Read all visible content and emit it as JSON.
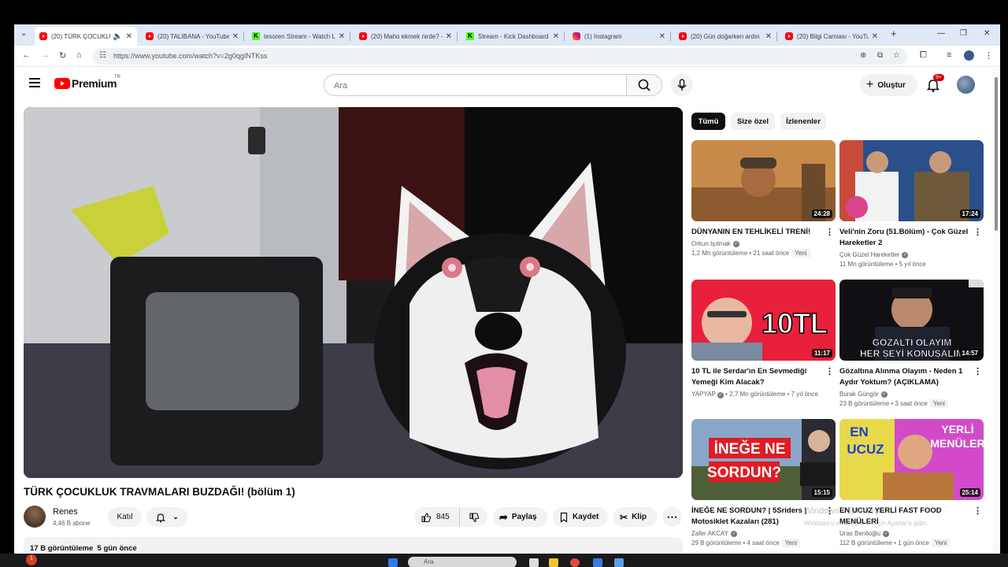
{
  "browser": {
    "tabs": [
      {
        "title": "(20) TÜRK ÇOCUKLUK",
        "icon": "youtube-icon",
        "active": true,
        "audio": true
      },
      {
        "title": "(20) TALIBANA - YouTube",
        "icon": "youtube-icon"
      },
      {
        "title": "texoren Stream - Watch L",
        "icon": "kick-icon"
      },
      {
        "title": "(20) Maho ekmek nirde? -",
        "icon": "youtube-icon"
      },
      {
        "title": "Stream - Kick Dashboard",
        "icon": "kick-icon"
      },
      {
        "title": "(1) Instagram",
        "icon": "instagram-icon"
      },
      {
        "title": "(20) Gün doğarken ardın",
        "icon": "youtube-icon"
      },
      {
        "title": "(20) Bilgi Camiası - YouTu",
        "icon": "youtube-icon"
      }
    ],
    "url": "https://www.youtube.com/watch?v=2g0qgINTKss"
  },
  "youtube": {
    "logo_text": "Premium",
    "country_code": "TR",
    "search_placeholder": "Ara",
    "create_label": "Oluştur",
    "notification_count": "9+"
  },
  "video": {
    "title": "TÜRK ÇOCUKLUK TRAVMALARI BUZDAĞI! (bölüm 1)",
    "channel": "Renes",
    "subscribers": "4,46 B abone",
    "join_label": "Katıl",
    "likes": "845",
    "share_label": "Paylaş",
    "save_label": "Kaydet",
    "clip_label": "Klip",
    "views": "17 B görüntüleme",
    "age": "5 gün önce"
  },
  "chips": [
    "Tümü",
    "Size özel",
    "İzlenenler"
  ],
  "recommendations": [
    {
      "title": "DÜNYANIN EN TEHLİKELİ TRENİ!",
      "channel": "Orkun Işıtmak",
      "verified": true,
      "views": "1,2 Mn görüntüleme",
      "age": "21 saat önce",
      "badge": "Yeni",
      "duration": "24:28"
    },
    {
      "title": "Veli'nin Zoru (51.Bölüm) - Çok Güzel Hareketler 2",
      "channel": "Çok Güzel Hareketler",
      "verified": true,
      "views": "11 Mn görüntüleme",
      "age": "5 yıl önce",
      "badge": "",
      "duration": "17:24"
    },
    {
      "title": "10 TL ile Serdar'ın En Sevmediği Yemeği Kim Alacak?",
      "channel": "YAPYAP",
      "verified": true,
      "views": "2,7 Mn görüntüleme",
      "age": "7 yıl önce",
      "badge": "",
      "duration": "11:17",
      "thumb_text": "10TL"
    },
    {
      "title": "Gözaltına Alınma Olayım - Neden 1 Aydır Yoktum? (AÇIKLAMA)",
      "channel": "Burak Güngör",
      "verified": true,
      "views": "23 B görüntüleme",
      "age": "3 saat önce",
      "badge": "Yeni",
      "duration": "14:57",
      "thumb_text": [
        "GÖZALTI OLAYIM",
        "HER ŞEYİ KONUŞALIM"
      ]
    },
    {
      "title": "İNEĞE NE SORDUN? | 5Sriders | Motosiklet Kazaları (281)",
      "channel": "Zafer AKCAY",
      "verified": true,
      "views": "29 B görüntüleme",
      "age": "4 saat önce",
      "badge": "Yeni",
      "duration": "15:15",
      "thumb_text": [
        "İNEĞE NE",
        "SORDUN?"
      ]
    },
    {
      "title": "EN UCUZ YERLİ FAST FOOD MENÜLERİ",
      "channel": "Uras Benlioğlu",
      "verified": true,
      "views": "112 B görüntüleme",
      "age": "1 gün önce",
      "badge": "Yeni",
      "duration": "25:14",
      "thumb_text": [
        "EN",
        "UCUZ",
        "YERLİ",
        "MENÜLER"
      ]
    }
  ],
  "watermark": {
    "line1": "Windows'u Etkinleştir",
    "line2": "Windows'u etkinleştirmek için Ayarlar'a gidin."
  },
  "taskbar": {
    "search_placeholder": "Ara",
    "notification_badge": "1"
  }
}
